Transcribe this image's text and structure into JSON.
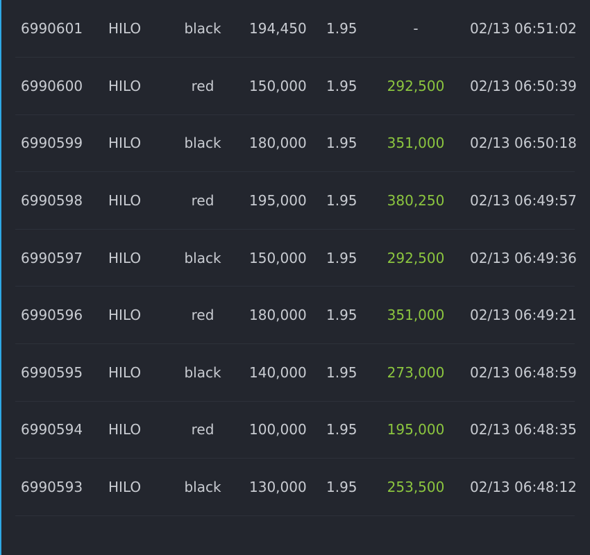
{
  "colors": {
    "background": "#23262e",
    "text": "#c9ccd2",
    "win": "#8cc63f",
    "divider": "#2d313a",
    "accent": "#2ea8e6"
  },
  "rows": [
    {
      "id": "6990601",
      "game": "HILO",
      "pick": "black",
      "bet": "194,450",
      "odds": "1.95",
      "win": "-",
      "time": "02/13 06:51:02"
    },
    {
      "id": "6990600",
      "game": "HILO",
      "pick": "red",
      "bet": "150,000",
      "odds": "1.95",
      "win": "292,500",
      "time": "02/13 06:50:39"
    },
    {
      "id": "6990599",
      "game": "HILO",
      "pick": "black",
      "bet": "180,000",
      "odds": "1.95",
      "win": "351,000",
      "time": "02/13 06:50:18"
    },
    {
      "id": "6990598",
      "game": "HILO",
      "pick": "red",
      "bet": "195,000",
      "odds": "1.95",
      "win": "380,250",
      "time": "02/13 06:49:57"
    },
    {
      "id": "6990597",
      "game": "HILO",
      "pick": "black",
      "bet": "150,000",
      "odds": "1.95",
      "win": "292,500",
      "time": "02/13 06:49:36"
    },
    {
      "id": "6990596",
      "game": "HILO",
      "pick": "red",
      "bet": "180,000",
      "odds": "1.95",
      "win": "351,000",
      "time": "02/13 06:49:21"
    },
    {
      "id": "6990595",
      "game": "HILO",
      "pick": "black",
      "bet": "140,000",
      "odds": "1.95",
      "win": "273,000",
      "time": "02/13 06:48:59"
    },
    {
      "id": "6990594",
      "game": "HILO",
      "pick": "red",
      "bet": "100,000",
      "odds": "1.95",
      "win": "195,000",
      "time": "02/13 06:48:35"
    },
    {
      "id": "6990593",
      "game": "HILO",
      "pick": "black",
      "bet": "130,000",
      "odds": "1.95",
      "win": "253,500",
      "time": "02/13 06:48:12"
    }
  ]
}
